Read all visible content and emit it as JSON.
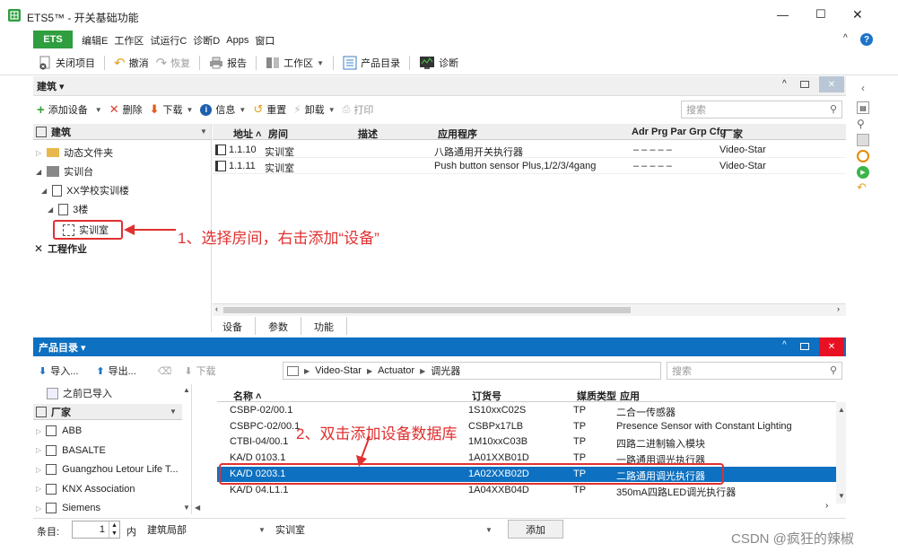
{
  "window": {
    "title": "ETS5™ - 开关基础功能",
    "minimize": "—",
    "maximize": "☐",
    "close": "✕"
  },
  "menu": {
    "ets": "ETS",
    "items": [
      "编辑E",
      "工作区",
      "试运行C",
      "诊断D",
      "Apps",
      "窗口"
    ]
  },
  "toolbar": {
    "close_project": "关闭项目",
    "undo": "撤消",
    "redo": "恢复",
    "report": "报告",
    "workspace": "工作区",
    "catalog": "产品目录",
    "diagnostics": "诊断"
  },
  "building": {
    "panel_title": "建筑 ▾",
    "toolbar": {
      "add_device": "添加设备",
      "delete": "删除",
      "download": "下载",
      "info": "信息",
      "reset": "重置",
      "unload": "卸载",
      "print": "打印",
      "search_placeholder": "搜索"
    },
    "tree_header": "建筑",
    "tree": {
      "dynamic_folder": "动态文件夹",
      "site": "实训台",
      "building": "XX学校实训楼",
      "floor": "3楼",
      "room": "实训室",
      "trades": "工程作业"
    },
    "columns": {
      "address": "地址 ˄",
      "room": "房间",
      "desc": "描述",
      "app": "应用程序",
      "flags": "Adr Prg Par Grp Cfg",
      "manufacturer": "厂家"
    },
    "rows": [
      {
        "address": "1.1.10",
        "room": "实训室",
        "desc": "",
        "app": "八路通用开关执行器",
        "flags": "–    –    –    –    –",
        "manufacturer": "Video-Star"
      },
      {
        "address": "1.1.11",
        "room": "实训室",
        "desc": "",
        "app": "Push button sensor Plus,1/2/3/4gang",
        "flags": "–    –    –    –    –",
        "manufacturer": "Video-Star"
      }
    ],
    "tabs": [
      "设备",
      "参数",
      "功能"
    ]
  },
  "annotations": {
    "step1": "1、选择房间，右击添加“设备”",
    "step2": "2、双击添加设备数据库"
  },
  "catalog": {
    "panel_title": "产品目录 ▾",
    "toolbar": {
      "import": "导入...",
      "export": "导出...",
      "download": "下载",
      "search_placeholder": "搜索"
    },
    "breadcrumb": [
      "Video-Star",
      "Actuator",
      "调光器"
    ],
    "left": {
      "imported": "之前已导入",
      "manufacturers_header": "厂家",
      "manufacturers": [
        "ABB",
        "BASALTE",
        "Guangzhou Letour Life T...",
        "KNX Association",
        "Siemens"
      ]
    },
    "columns": {
      "name": "名称 ˄",
      "order": "订货号",
      "medium": "媒质类型",
      "app": "应用"
    },
    "rows": [
      {
        "name": "CSBP-02/00.1",
        "order": "1S10xxC02S",
        "medium": "TP",
        "app": "二合一传感器"
      },
      {
        "name": "CSBPC-02/00.1",
        "order": "CSBPx17LB",
        "medium": "TP",
        "app": "Presence Sensor with Constant Lighting"
      },
      {
        "name": "CTBI-04/00.1",
        "order": "1M10xxC03B",
        "medium": "TP",
        "app": "四路二进制输入模块"
      },
      {
        "name": "KA/D 0103.1",
        "order": "1A01XXB01D",
        "medium": "TP",
        "app": "一路通用调光执行器"
      },
      {
        "name": "KA/D 0203.1",
        "order": "1A02XXB02D",
        "medium": "TP",
        "app": "二路通用调光执行器"
      },
      {
        "name": "KA/D 04.L1.1",
        "order": "1A04XXB04D",
        "medium": "TP",
        "app": "350mA四路LED调光执行器"
      }
    ],
    "selected_index": 4
  },
  "status": {
    "count_label": "条目:",
    "count_value": "1",
    "in_label": "内",
    "building_part": "建筑局部",
    "room": "实训室",
    "add_button": "添加"
  },
  "watermark": "CSDN @疯狂的辣椒",
  "colors": {
    "accent": "#0e70c0",
    "ets_green": "#2e9e3e",
    "annotation_red": "#e03030",
    "selection": "#0e70c0"
  }
}
